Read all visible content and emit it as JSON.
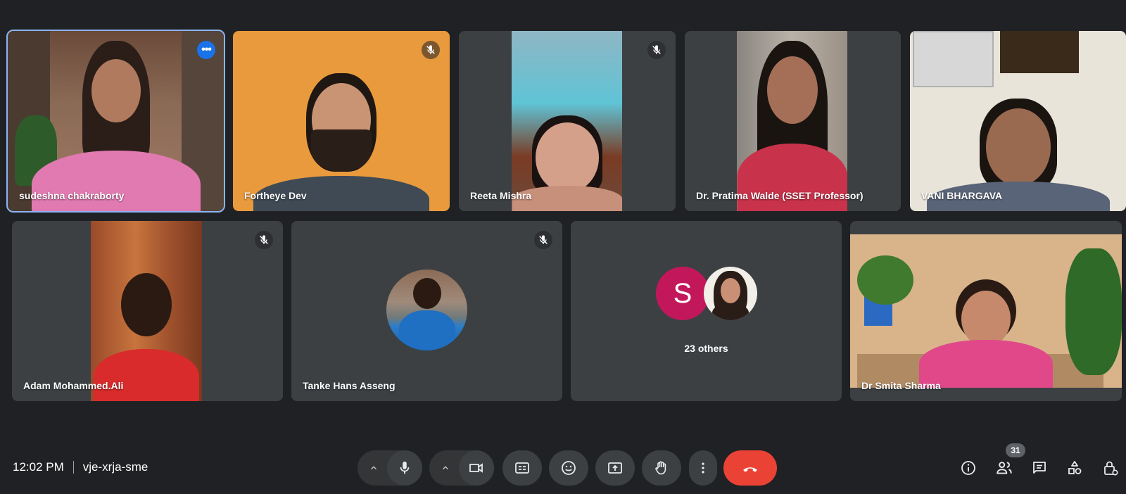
{
  "participants": [
    {
      "name": "sudeshna chakraborty"
    },
    {
      "name": "Fortheye Dev"
    },
    {
      "name": "Reeta Mishra"
    },
    {
      "name": "Dr. Pratima Walde (SSET Professor)"
    },
    {
      "name": "VANI BHARGAVA"
    },
    {
      "name": "Adam Mohammed.Ali"
    },
    {
      "name": "Tanke Hans Asseng"
    },
    {
      "name": "Dr Smita Sharma"
    }
  ],
  "others": {
    "label": "23 others",
    "avatar_initial": "S"
  },
  "meeting": {
    "time": "12:02 PM",
    "code": "vje-xrja-sme"
  },
  "people_count": "31",
  "icons": {
    "mute": "mic-off-icon",
    "more": "more-options-icon",
    "mic": "mic-icon",
    "camera": "videocam-icon",
    "captions": "closed-captions-icon",
    "emoji": "emoji-icon",
    "present": "present-screen-icon",
    "hand": "raise-hand-icon",
    "more_vert": "more-vert-icon",
    "end_call": "end-call-icon",
    "info": "info-icon",
    "people": "people-icon",
    "chat": "chat-icon",
    "activities": "activities-icon",
    "host_controls": "host-controls-icon"
  },
  "colors": {
    "background": "#202124",
    "tile": "#3c4043",
    "end_call": "#ea4335",
    "active_outline": "#8ab4f8"
  }
}
